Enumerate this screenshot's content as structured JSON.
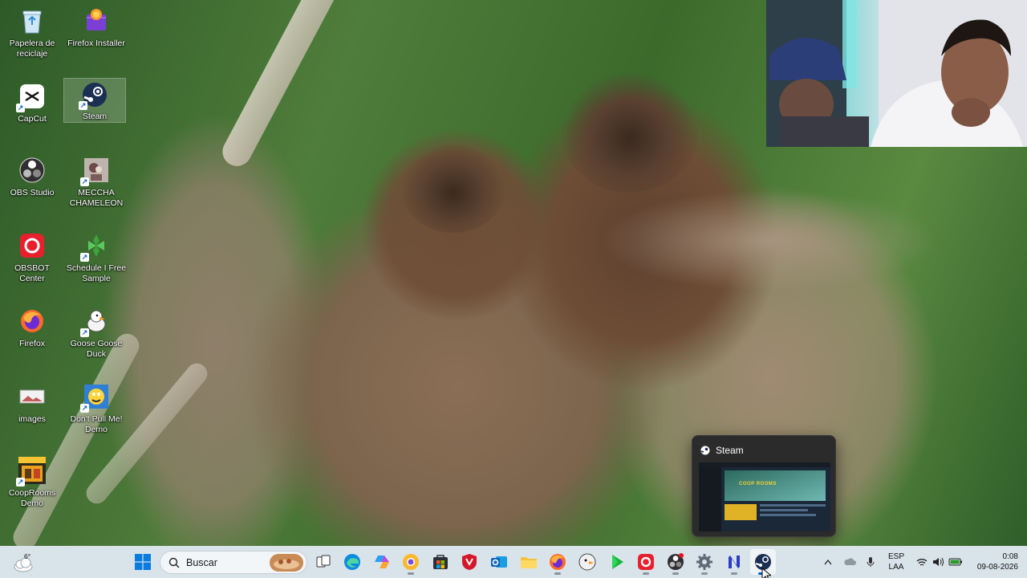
{
  "desktop": {
    "icons": [
      {
        "label": "Papelera de reciclaje",
        "icon": "recycle-bin-icon"
      },
      {
        "label": "Firefox Installer",
        "icon": "firefox-installer-icon"
      },
      {
        "label": "CapCut",
        "icon": "capcut-icon"
      },
      {
        "label": "Steam",
        "icon": "steam-icon"
      },
      {
        "label": "OBS Studio",
        "icon": "obs-icon"
      },
      {
        "label": "MECCHA CHAMELEON",
        "icon": "chameleon-game-icon"
      },
      {
        "label": "OBSBOT Center",
        "icon": "obsbot-icon"
      },
      {
        "label": "Schedule I Free Sample",
        "icon": "schedule-one-icon"
      },
      {
        "label": "Firefox",
        "icon": "firefox-icon"
      },
      {
        "label": "Goose Goose Duck",
        "icon": "goose-icon"
      },
      {
        "label": "images",
        "icon": "image-file-icon"
      },
      {
        "label": "Don't Pull Me! Demo",
        "icon": "dont-pull-me-icon"
      },
      {
        "label": "CoopRooms Demo",
        "icon": "cooprooms-icon"
      }
    ]
  },
  "thumbnail": {
    "title": "Steam",
    "preview_banner": "COOP ROOMS"
  },
  "taskbar": {
    "weather": {
      "temp": "6°",
      "icon": "weather-cloud-icon"
    },
    "search_placeholder": "Buscar",
    "apps": [
      "windows-start-icon",
      "task-view-icon",
      "edge-icon",
      "copilot-icon",
      "chrome-canary-icon",
      "microsoft-store-icon",
      "shield-app-icon",
      "outlook-icon",
      "file-explorer-icon",
      "firefox-icon",
      "goose-app-icon",
      "play-app-icon",
      "obsbot-app-icon",
      "obs-app-icon",
      "settings-icon",
      "notion-icon",
      "steam-icon"
    ],
    "tray": {
      "language": "ESP",
      "layout": "LAA",
      "time": "0:08",
      "date": "09-08-2026"
    }
  },
  "colors": {
    "taskbar_bg": "#d9e3ea",
    "accent": "#0067c0",
    "steam_bg": "#1b2838"
  }
}
